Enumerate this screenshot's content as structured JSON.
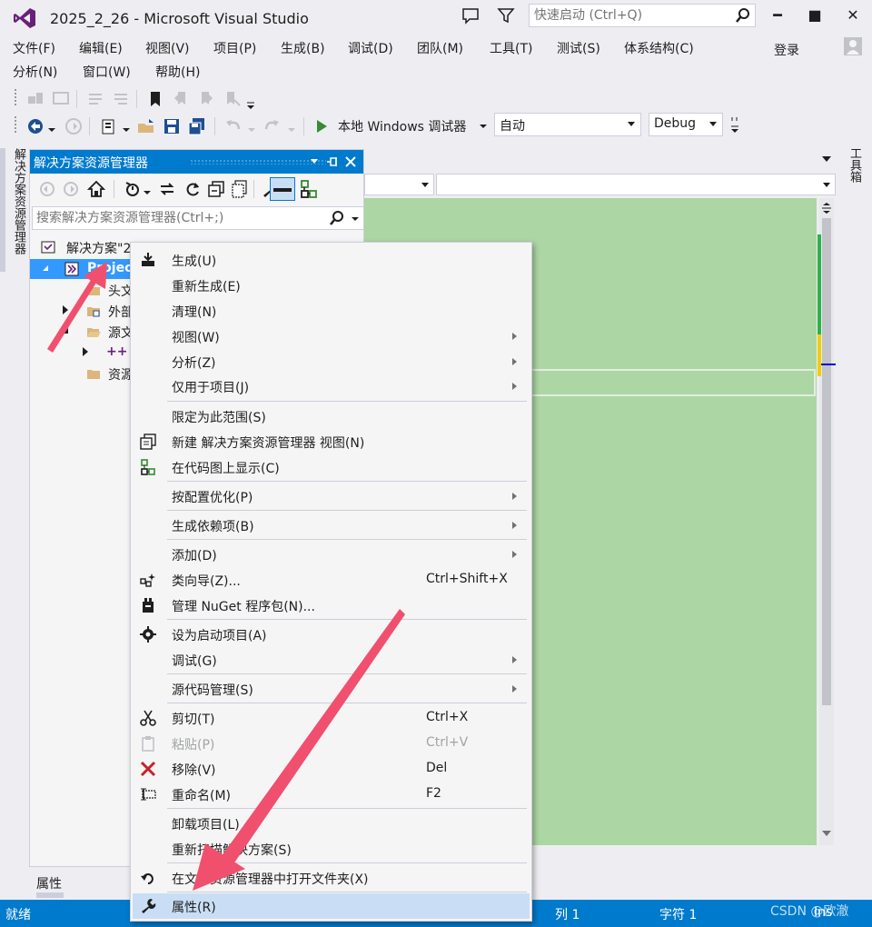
{
  "window": {
    "title": "2025_2_26 - Microsoft Visual Studio",
    "quick_launch_placeholder": "快速启动 (Ctrl+Q)",
    "signin": "登录",
    "minimize": "━",
    "maximize": "■",
    "close": "✕"
  },
  "menubar": {
    "row1": [
      "文件(F)",
      "编辑(E)",
      "视图(V)",
      "项目(P)",
      "生成(B)",
      "调试(D)",
      "团队(M)",
      "工具(T)",
      "测试(S)",
      "体系结构(C)"
    ],
    "row2": [
      "分析(N)",
      "窗口(W)",
      "帮助(H)"
    ]
  },
  "toolbar": {
    "debugger_label": "本地 Windows 调试器",
    "config_combo": "自动",
    "build_combo": "Debug"
  },
  "side_tabs": {
    "left": "解决方案资源管理器",
    "right": "工具箱"
  },
  "solution_explorer": {
    "title": "解决方案资源管理器",
    "search_placeholder": "搜索解决方案资源管理器(Ctrl+;)",
    "tree": [
      {
        "label": "解决方案\"2",
        "icon": "solution-icon"
      },
      {
        "label": "Projec",
        "icon": "project-icon",
        "selected": true
      },
      {
        "label": "头文",
        "icon": "folder-icon"
      },
      {
        "label": "外部",
        "icon": "external-deps-icon"
      },
      {
        "label": "源文",
        "icon": "folder-open-icon"
      },
      {
        "label": "++",
        "icon": "cpp-file-icon"
      },
      {
        "label": "资源",
        "icon": "folder-icon"
      }
    ]
  },
  "context_menu": {
    "items": [
      {
        "label": "生成(U)",
        "icon": "build-icon",
        "shortcut": "",
        "submenu": false
      },
      {
        "label": "重新生成(E)",
        "icon": "",
        "shortcut": "",
        "submenu": false
      },
      {
        "label": "清理(N)",
        "icon": "",
        "shortcut": "",
        "submenu": false
      },
      {
        "label": "视图(W)",
        "icon": "",
        "shortcut": "",
        "submenu": true
      },
      {
        "label": "分析(Z)",
        "icon": "",
        "shortcut": "",
        "submenu": true
      },
      {
        "label": "仅用于项目(J)",
        "icon": "",
        "shortcut": "",
        "submenu": true
      },
      {
        "label": "限定为此范围(S)",
        "icon": "",
        "shortcut": "",
        "submenu": false
      },
      {
        "label": "新建 解决方案资源管理器 视图(N)",
        "icon": "new-view-icon",
        "shortcut": "",
        "submenu": false
      },
      {
        "label": "在代码图上显示(C)",
        "icon": "code-map-icon",
        "shortcut": "",
        "submenu": false
      },
      {
        "label": "按配置优化(P)",
        "icon": "",
        "shortcut": "",
        "submenu": true
      },
      {
        "label": "生成依赖项(B)",
        "icon": "",
        "shortcut": "",
        "submenu": true
      },
      {
        "label": "添加(D)",
        "icon": "",
        "shortcut": "",
        "submenu": true
      },
      {
        "label": "类向导(Z)...",
        "icon": "class-wizard-icon",
        "shortcut": "Ctrl+Shift+X",
        "submenu": false
      },
      {
        "label": "管理 NuGet 程序包(N)...",
        "icon": "nuget-icon",
        "shortcut": "",
        "submenu": false
      },
      {
        "label": "设为启动项目(A)",
        "icon": "gear-icon",
        "shortcut": "",
        "submenu": false
      },
      {
        "label": "调试(G)",
        "icon": "",
        "shortcut": "",
        "submenu": true
      },
      {
        "label": "源代码管理(S)",
        "icon": "",
        "shortcut": "",
        "submenu": true
      },
      {
        "label": "剪切(T)",
        "icon": "scissors-icon",
        "shortcut": "Ctrl+X",
        "submenu": false
      },
      {
        "label": "粘贴(P)",
        "icon": "paste-icon",
        "shortcut": "Ctrl+V",
        "submenu": false,
        "disabled": true
      },
      {
        "label": "移除(V)",
        "icon": "remove-icon",
        "shortcut": "Del",
        "submenu": false
      },
      {
        "label": "重命名(M)",
        "icon": "rename-icon",
        "shortcut": "F2",
        "submenu": false
      },
      {
        "label": "卸载项目(L)",
        "icon": "",
        "shortcut": "",
        "submenu": false
      },
      {
        "label": "重新扫描解决方案(S)",
        "icon": "",
        "shortcut": "",
        "submenu": false
      },
      {
        "label": "在文件资源管理器中打开文件夹(X)",
        "icon": "open-folder-arrow-icon",
        "shortcut": "",
        "submenu": false
      },
      {
        "label": "属性(R)",
        "icon": "wrench-icon",
        "shortcut": "",
        "submenu": false,
        "highlighted": true
      }
    ]
  },
  "properties_tab": "属性",
  "statusbar": {
    "ready": "就绪",
    "line": "列 1",
    "char": "字符 1",
    "ins": "Ins",
    "watermark": "CSDN @欧澈"
  },
  "colors": {
    "accent": "#007acc",
    "editor_bg": "#acd6a3",
    "annotation_arrow": "#f0506e",
    "menu_highlight": "#c9def5"
  }
}
